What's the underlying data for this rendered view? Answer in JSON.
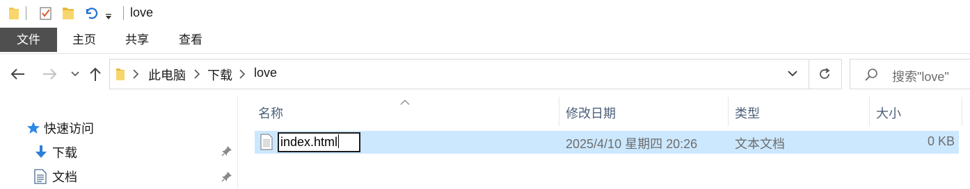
{
  "window": {
    "title": "love"
  },
  "quick_access_toolbar": {
    "icons": [
      "folder-icon",
      "properties-checkbox-icon",
      "new-folder-icon",
      "undo-icon",
      "customize-dropdown-icon"
    ]
  },
  "ribbon": {
    "tabs": [
      {
        "label": "文件",
        "active": true
      },
      {
        "label": "主页"
      },
      {
        "label": "共享"
      },
      {
        "label": "查看"
      }
    ]
  },
  "address_bar": {
    "breadcrumb": [
      "此电脑",
      "下载",
      "love"
    ]
  },
  "search": {
    "placeholder": "搜索\"love\""
  },
  "nav_pane": {
    "items": [
      {
        "label": "快速访问",
        "icon": "star-icon",
        "pinned": false
      },
      {
        "label": "下载",
        "icon": "download-arrow-icon",
        "pinned": true
      },
      {
        "label": "文档",
        "icon": "document-icon",
        "pinned": true
      }
    ]
  },
  "file_list": {
    "columns": [
      "名称",
      "修改日期",
      "类型",
      "大小"
    ],
    "rows": [
      {
        "name": "index.html",
        "modified": "2025/4/10 星期四 20:26",
        "type": "文本文档",
        "size": "0 KB",
        "selected": true,
        "renaming": true
      }
    ]
  },
  "colors": {
    "ribbon_file_tab": "#4f4f4f",
    "selection": "#cce8ff",
    "folder": "#f4c64e",
    "header_text": "#4c607a"
  }
}
